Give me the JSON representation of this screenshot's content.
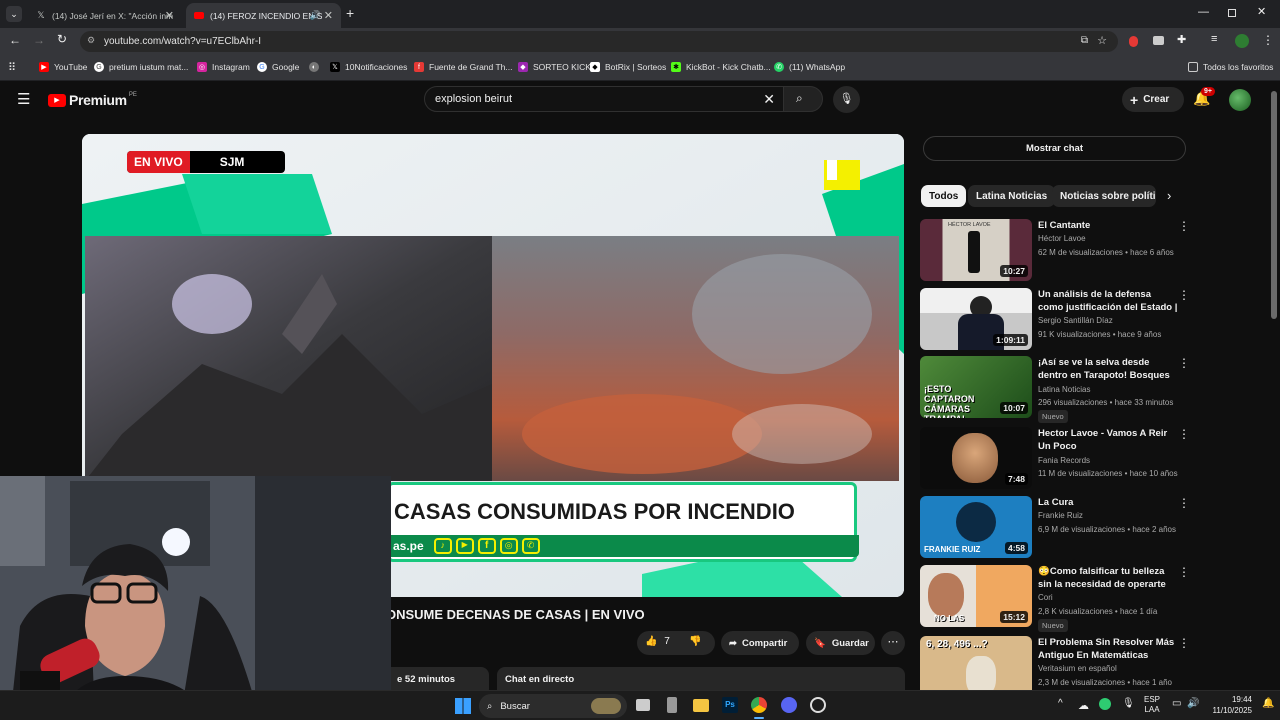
{
  "tabs": [
    {
      "title": "(14) José Jerí en X: \"Acción inm"
    },
    {
      "title": "(14) FEROZ INCENDIO EN S"
    }
  ],
  "address": {
    "url": "youtube.com/watch?v=u7EClbAhr-I"
  },
  "bookmarks": [
    "YouTube",
    "pretium iustum mat...",
    "Instagram",
    "Google",
    "10Notificaciones",
    "Fuente de Grand Th...",
    "SORTEO KICK",
    "BotRix | Sorteos",
    "KickBot - Kick Chatb...",
    "(11) WhatsApp"
  ],
  "bookmarks_all": "Todos los favoritos",
  "yt": {
    "logo": "Premium",
    "region": "PE",
    "search_value": "explosion beirut",
    "create_label": "Crear",
    "notif_count": "9+"
  },
  "video": {
    "live_label": "EN VIVO",
    "location_tag": "SJM",
    "banner": "CASAS CONSUMIDAS POR INCENDIO",
    "site": "as.pe",
    "title": "ONSUME DECENAS DE CASAS | EN VIVO",
    "likes": "7",
    "share": "Compartir",
    "save": "Guardar",
    "elapsed": "e 52 minutos",
    "chat_label": "Chat en directo"
  },
  "show_chat": "Mostrar chat",
  "chips": [
    "Todos",
    "Latina Noticias",
    "Noticias sobre política"
  ],
  "recs": [
    {
      "title": "El Cantante",
      "channel": "Héctor Lavoe",
      "meta": "62 M de visualizaciones • hace 6 años",
      "dur": "10:27",
      "badge": ""
    },
    {
      "title": "Un análisis de la defensa como justificación del Estado | Migu...",
      "channel": "Sergio Santillán Díaz",
      "meta": "91 K visualizaciones • hace 9 años",
      "dur": "1:09:11",
      "badge": ""
    },
    {
      "title": "¡Así se ve la selva desde dentro en Tarapoto! Bosques ...",
      "channel": "Latina Noticias",
      "meta": "296 visualizaciones • hace 33 minutos",
      "dur": "10:07",
      "badge": "Nuevo"
    },
    {
      "title": "Hector Lavoe - Vamos A Reir Un Poco",
      "channel": "Fania Records",
      "meta": "11 M de visualizaciones • hace 10 años",
      "dur": "7:48",
      "badge": ""
    },
    {
      "title": "La Cura",
      "channel": "Frankie Ruiz",
      "meta": "6,9 M de visualizaciones • hace 2 años",
      "dur": "4:58",
      "badge": ""
    },
    {
      "title": "😳Como falsificar tu belleza sin la necesidad de operarte 😳",
      "channel": "Cori",
      "meta": "2,8 K visualizaciones • hace 1 día",
      "dur": "15:12",
      "badge": "Nuevo"
    },
    {
      "title": "El Problema Sin Resolver Más Antiguo En Matemáticas",
      "channel": "Veritasium en español",
      "meta": "2,3 M de visualizaciones • hace 1 año",
      "dur": "",
      "badge": ""
    }
  ],
  "thumb_text": {
    "t1": "HÉCTOR LAVOE",
    "t3": "¡ESTO CAPTARON CÁMARAS TRAMPA!",
    "t5": "FRANKIE RUIZ",
    "t6": "NO LAS",
    "t7": "6, 28, 496 ...?"
  },
  "taskbar": {
    "search": "Buscar",
    "lang": "ESP",
    "lang2": "LAA",
    "time": "19:44",
    "date": "11/10/2025"
  },
  "colors": {
    "yt_red": "#ff0000",
    "latina_green": "#00d68f",
    "bg": "#0f0f0f"
  }
}
